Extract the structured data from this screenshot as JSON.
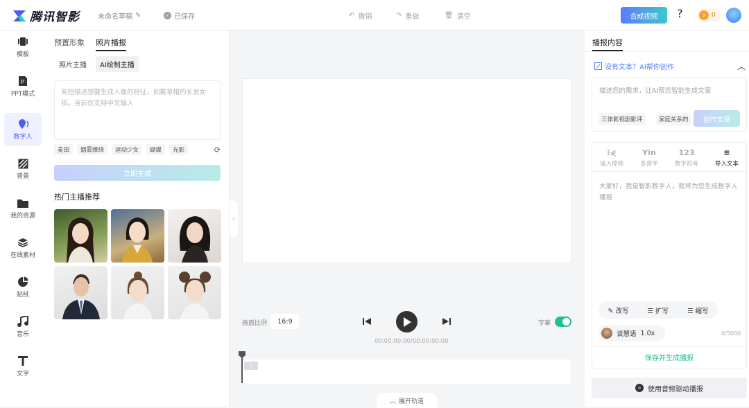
{
  "topbar": {
    "brand": "腾讯智影",
    "draft_title": "未命名草稿",
    "saved": "已保存",
    "undo": "撤销",
    "redo": "重做",
    "clear": "清空",
    "compose": "合成视频",
    "help": "?",
    "coin_count": "0",
    "brand_color": "#4b5cf0"
  },
  "sidebar": {
    "items": [
      {
        "label": "模板",
        "icon": "template-icon"
      },
      {
        "label": "PPT模式",
        "icon": "ppt-icon"
      },
      {
        "label": "数字人",
        "icon": "digital-human-icon"
      },
      {
        "label": "背景",
        "icon": "background-icon"
      },
      {
        "label": "我的资源",
        "icon": "folder-icon"
      },
      {
        "label": "在线素材",
        "icon": "layers-icon"
      },
      {
        "label": "贴纸",
        "icon": "sticker-icon"
      },
      {
        "label": "音乐",
        "icon": "music-icon"
      },
      {
        "label": "文字",
        "icon": "text-icon"
      }
    ],
    "active_index": 2
  },
  "left_panel": {
    "tabs": [
      "预置形象",
      "照片播报"
    ],
    "active_tab": 1,
    "subtabs": [
      "照片主播",
      "AI绘制主播"
    ],
    "active_subtab": 1,
    "prompt_placeholder": "简短描述想要生成人像的特征，如戴草帽的长发女孩。当前仅支持中文输入",
    "chips": [
      "麦田",
      "烟雾缭绕",
      "运动少女",
      "蝴蝶",
      "光影"
    ],
    "generate": "立即生成",
    "hot_title": "热门主播推荐"
  },
  "stage": {
    "ratio_label": "画面比例",
    "ratio_value": "16:9",
    "timecode": "00:00:00:00/00:00:00:00",
    "subtitle_label": "字幕",
    "subtitle_on": true,
    "track_badge": "1",
    "expand": "展开轨道"
  },
  "right_panel": {
    "title": "播报内容",
    "ai_link": "没有文本？AI帮你创作",
    "ai_placeholder": "描述您的需求，让AI帮您智能生成文案",
    "ai_chips": [
      "三体影视剧影评",
      "家庭关系的"
    ],
    "ai_create": "创作文章",
    "tools": [
      "插入停顿",
      "多音字",
      "数字符号",
      "导入文本"
    ],
    "tool_glyphs": [
      "⁝⋞",
      "Yin",
      "123",
      "≡"
    ],
    "script_text": "大家好，我是智影数字人，我将为您生成数字人播报",
    "edits": [
      "改写",
      "扩写",
      "缩写"
    ],
    "voice_name": "谈慧语",
    "voice_speed": "1.0x",
    "counter": "0/5000",
    "save_generate": "保存并生成播报",
    "audio_drive": "使用音频驱动播报"
  }
}
